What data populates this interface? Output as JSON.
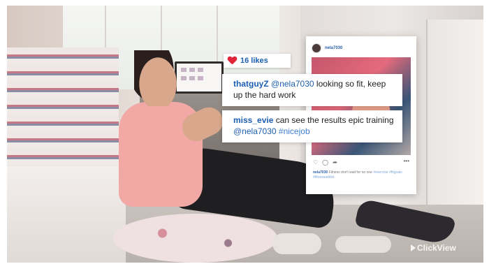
{
  "post": {
    "username": "nela7030",
    "caption_user": "nela7030",
    "caption_text": "Fitness don't wait for no one",
    "caption_tags": "#exercise #fitgoals #fitnessaddict"
  },
  "likes": {
    "count_label": "16 likes",
    "icon": "heart-icon",
    "color": "#e0243a"
  },
  "comments": [
    {
      "user": "thatguyZ",
      "text_before": "",
      "mention": "@nela7030",
      "text_after": " looking so fit, keep up the hard work",
      "tag": ""
    },
    {
      "user": "miss_evie",
      "text_before": " can see the results epic training ",
      "mention": "@nela7030",
      "text_after": " ",
      "tag": "#nicejob"
    }
  ],
  "watermark": {
    "brand": "ClickView"
  },
  "colors": {
    "link_blue": "#1c5fb3"
  }
}
